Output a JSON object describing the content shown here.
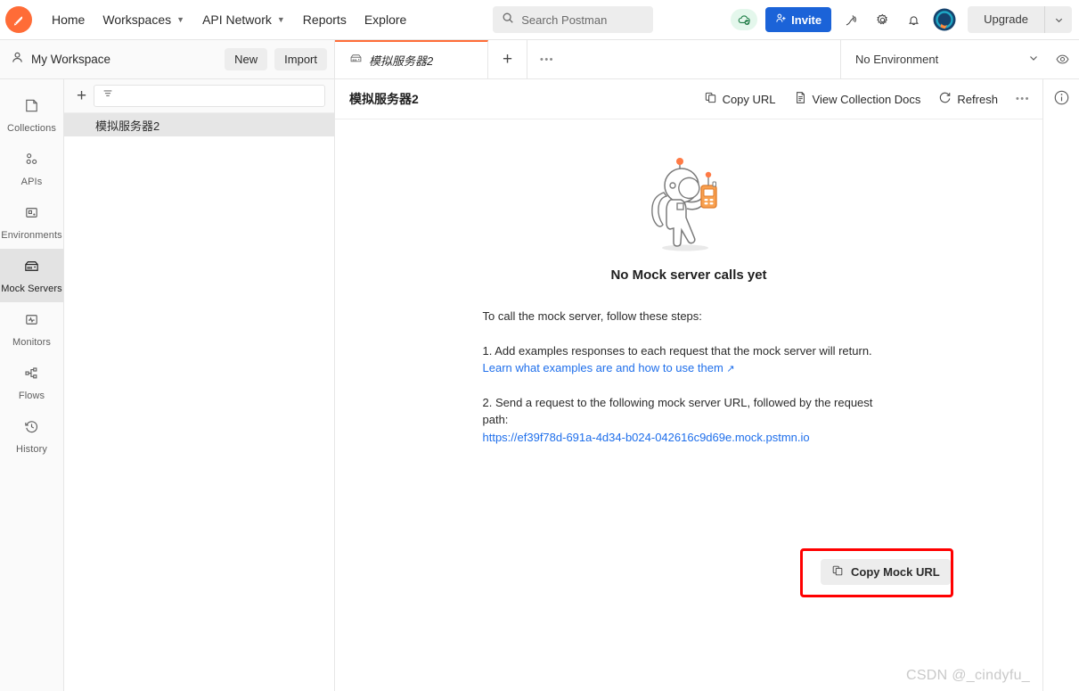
{
  "topbar": {
    "logo_icon": "postman-logo-icon",
    "nav": [
      {
        "label": "Home",
        "has_chevron": false
      },
      {
        "label": "Workspaces",
        "has_chevron": true
      },
      {
        "label": "API Network",
        "has_chevron": true
      },
      {
        "label": "Reports",
        "has_chevron": false
      },
      {
        "label": "Explore",
        "has_chevron": false
      }
    ],
    "search_placeholder": "Search Postman",
    "sync_icon": "cloud-check-icon",
    "invite_label": "Invite",
    "invite_icon": "user-plus-icon",
    "satellite_icon": "satellite-icon",
    "settings_icon": "gear-icon",
    "notifications_icon": "bell-icon",
    "avatar_icon": "user-avatar",
    "upgrade_label": "Upgrade",
    "upgrade_chevron_icon": "chevron-down-icon",
    "accent_color": "#ff6c37",
    "invite_color": "#1b63d8"
  },
  "secondbar": {
    "workspace_icon": "person-icon",
    "workspace_name": "My Workspace",
    "new_label": "New",
    "import_label": "Import",
    "tabs": [
      {
        "label": "模拟服务器2",
        "icon": "mock-server-icon",
        "active": true
      }
    ],
    "new_tab_icon": "plus-icon",
    "tab_more_icon": "ellipsis-icon",
    "environment_label": "No Environment",
    "env_chevron_icon": "chevron-down-icon",
    "env_eye_icon": "eye-icon"
  },
  "sidebar": {
    "items": [
      {
        "label": "Collections",
        "icon": "collections-icon",
        "active": false
      },
      {
        "label": "APIs",
        "icon": "apis-icon",
        "active": false
      },
      {
        "label": "Environments",
        "icon": "environments-icon",
        "active": false
      },
      {
        "label": "Mock Servers",
        "icon": "mock-server-icon",
        "active": true
      },
      {
        "label": "Monitors",
        "icon": "monitors-icon",
        "active": false
      },
      {
        "label": "Flows",
        "icon": "flows-icon",
        "active": false
      },
      {
        "label": "History",
        "icon": "history-icon",
        "active": false
      }
    ]
  },
  "collection_panel": {
    "add_icon": "plus-icon",
    "filter_icon": "filter-icon",
    "filter_placeholder": "",
    "items": [
      {
        "label": "模拟服务器2",
        "selected": true
      }
    ]
  },
  "main": {
    "title": "模拟服务器2",
    "actions": [
      {
        "label": "Copy URL",
        "icon": "copy-icon"
      },
      {
        "label": "View Collection Docs",
        "icon": "document-icon"
      },
      {
        "label": "Refresh",
        "icon": "refresh-icon"
      }
    ],
    "more_icon": "ellipsis-icon",
    "illustration": "astronaut-with-radio-illustration",
    "empty_title": "No Mock server calls yet",
    "intro": "To call the mock server, follow these steps:",
    "step1": "1. Add examples responses to each request that the mock server will return.",
    "step1_link": "Learn what examples are and how to use them",
    "step1_link_arrow": "↗",
    "step2": "2. Send a request to the following mock server URL, followed by the request path:",
    "mock_url": "https://ef39f78d-691a-4d34-b024-042616c9d69e.mock.pstmn.io",
    "copy_mock_label": "Copy Mock URL",
    "copy_mock_icon": "copy-icon",
    "highlight_color": "#ff0000",
    "link_color": "#1f6feb"
  },
  "right_rail": {
    "info_icon": "info-circle-icon"
  },
  "watermark": "CSDN @_cindyfu_"
}
